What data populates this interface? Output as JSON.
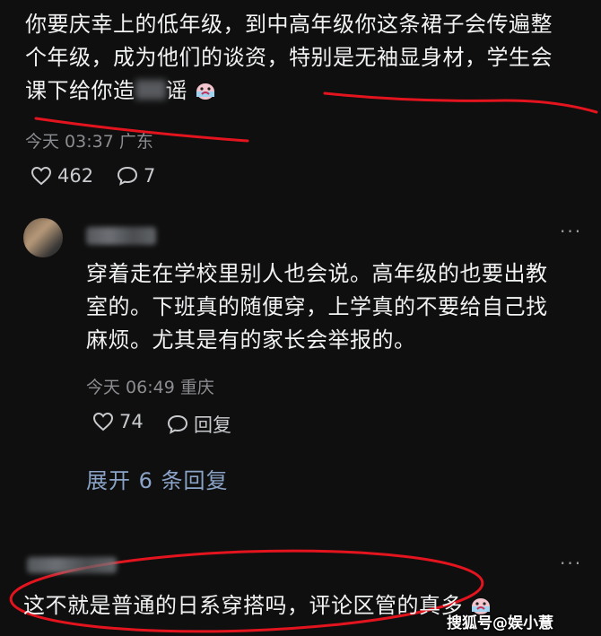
{
  "comment1": {
    "line1": "你要庆幸上的低年级，到中高年级你这条裙子会传遍整",
    "line2": "个年级，成为他们的谈资，特别是无袖显身材，学生会",
    "line3": "课下给你造",
    "line3_tail": "谣",
    "time_location": "今天 03:37 广东",
    "likes": "462",
    "replies": "7"
  },
  "reply": {
    "line1": "穿着走在学校里别人也会说。高年级的也要出教",
    "line2": "室的。下班真的随便穿，上学真的不要给自己找",
    "line3": "麻烦。尤其是有的家长会举报的。",
    "time_location": "今天 06:49 重庆",
    "likes": "74",
    "reply_label": "回复",
    "more": "···"
  },
  "expand_label": "展开 6 条回复",
  "comment2": {
    "text": "这不就是普通的日系穿搭吗，评论区管的真多",
    "more": "···"
  },
  "watermark": "搜狐号@娱小薏",
  "colors": {
    "annotation": "#e3141e",
    "background": "#0f0f0f",
    "link": "#8aa3c7"
  },
  "icons": [
    "heart-icon",
    "comment-bubble-icon",
    "more-dots-icon",
    "crying-emoji-icon"
  ]
}
